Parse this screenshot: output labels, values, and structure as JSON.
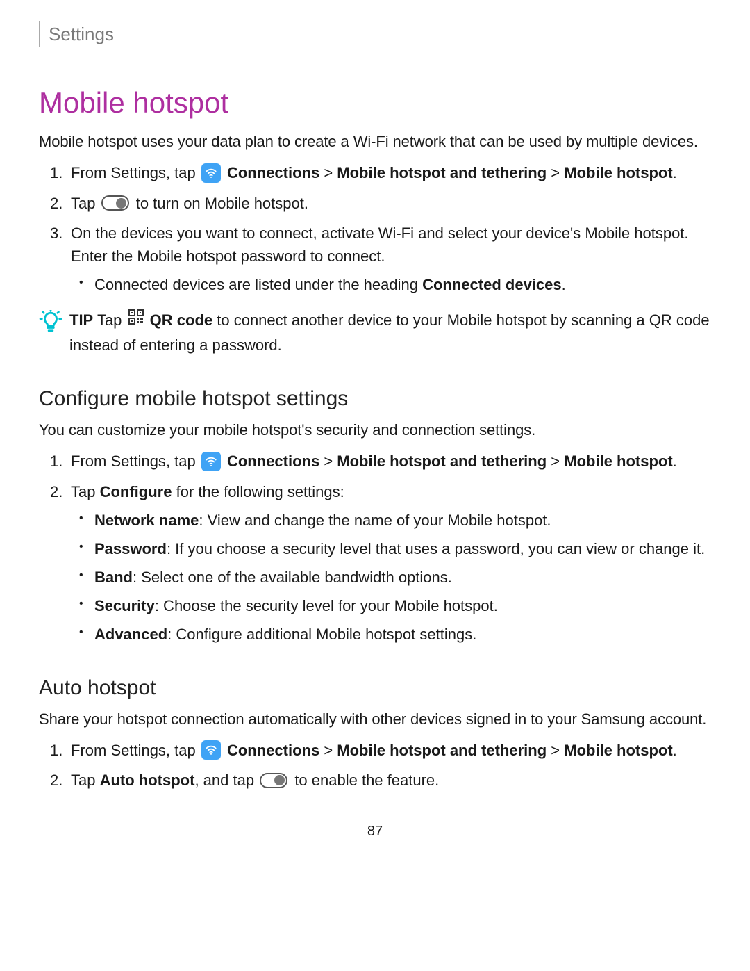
{
  "breadcrumb": "Settings",
  "title": "Mobile hotspot",
  "intro": "Mobile hotspot uses your data plan to create a Wi-Fi network that can be used by multiple devices.",
  "steps1": {
    "s1_pre": "From Settings, tap ",
    "s1_b1": "Connections",
    "s1_gt1": " > ",
    "s1_b2": "Mobile hotspot and tethering",
    "s1_gt2": " > ",
    "s1_b3": "Mobile hotspot",
    "s1_post": ".",
    "s2_pre": "Tap ",
    "s2_post": " to turn on Mobile hotspot.",
    "s3": "On the devices you want to connect, activate Wi-Fi and select your device's Mobile hotspot. Enter the Mobile hotspot password to connect.",
    "s3_sub_pre": "Connected devices are listed under the heading ",
    "s3_sub_b": "Connected devices",
    "s3_sub_post": "."
  },
  "tip": {
    "label": "TIP",
    "pre": "  Tap ",
    "qr_b": "QR code",
    "post": " to connect another device to your Mobile hotspot by scanning a QR code instead of entering a password."
  },
  "section2": {
    "heading": "Configure mobile hotspot settings",
    "intro": "You can customize your mobile hotspot's security and connection settings.",
    "s1_pre": "From Settings, tap ",
    "s1_b1": "Connections",
    "s1_gt1": " > ",
    "s1_b2": "Mobile hotspot and tethering",
    "s1_gt2": " > ",
    "s1_b3": "Mobile hotspot",
    "s1_post": ".",
    "s2_pre": "Tap ",
    "s2_b": "Configure",
    "s2_post": " for the following settings:",
    "opts": {
      "o1_b": "Network name",
      "o1_t": ": View and change the name of your Mobile hotspot.",
      "o2_b": "Password",
      "o2_t": ": If you choose a security level that uses a password, you can view or change it.",
      "o3_b": "Band",
      "o3_t": ": Select one of the available bandwidth options.",
      "o4_b": "Security",
      "o4_t": ": Choose the security level for your Mobile hotspot.",
      "o5_b": "Advanced",
      "o5_t": ": Configure additional Mobile hotspot settings."
    }
  },
  "section3": {
    "heading": "Auto hotspot",
    "intro": "Share your hotspot connection automatically with other devices signed in to your Samsung account.",
    "s1_pre": "From Settings, tap ",
    "s1_b1": "Connections",
    "s1_gt1": " > ",
    "s1_b2": "Mobile hotspot and tethering",
    "s1_gt2": " > ",
    "s1_b3": "Mobile hotspot",
    "s1_post": ".",
    "s2_pre": "Tap ",
    "s2_b": "Auto hotspot",
    "s2_mid": ", and tap ",
    "s2_post": " to enable the feature."
  },
  "page_number": "87"
}
